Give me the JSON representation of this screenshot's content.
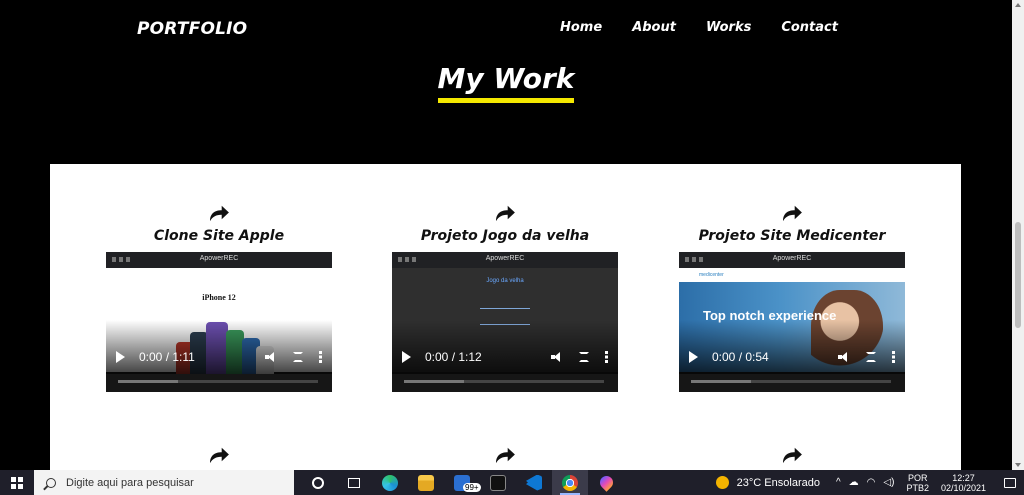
{
  "header": {
    "brand": "PORTFOLIO",
    "nav": [
      "Home",
      "About",
      "Works",
      "Contact"
    ],
    "section_title": "My Work"
  },
  "colors": {
    "accent": "#f4e800",
    "background": "#000000",
    "panel": "#ffffff"
  },
  "projects": [
    {
      "title": "Clone Site Apple",
      "time": "0:00 / 1:11",
      "icon": "share-arrow-icon",
      "preview_title": "iPhone 12"
    },
    {
      "title": "Projeto Jogo da velha",
      "time": "0:00 / 1:12",
      "icon": "share-arrow-icon",
      "preview_title": "Jogo da velha"
    },
    {
      "title": "Projeto Site Medicenter",
      "time": "0:00 / 0:54",
      "icon": "share-arrow-icon",
      "preview_title": "Top notch experience",
      "preview_logo": "medicenter"
    }
  ],
  "video_watermark": "ApowerREC",
  "taskbar": {
    "search_placeholder": "Digite aqui para pesquisar",
    "badge": "99+",
    "weather": "23°C Ensolarado",
    "lang_1": "POR",
    "lang_2": "PTB2",
    "time": "12:27",
    "date": "02/10/2021"
  }
}
